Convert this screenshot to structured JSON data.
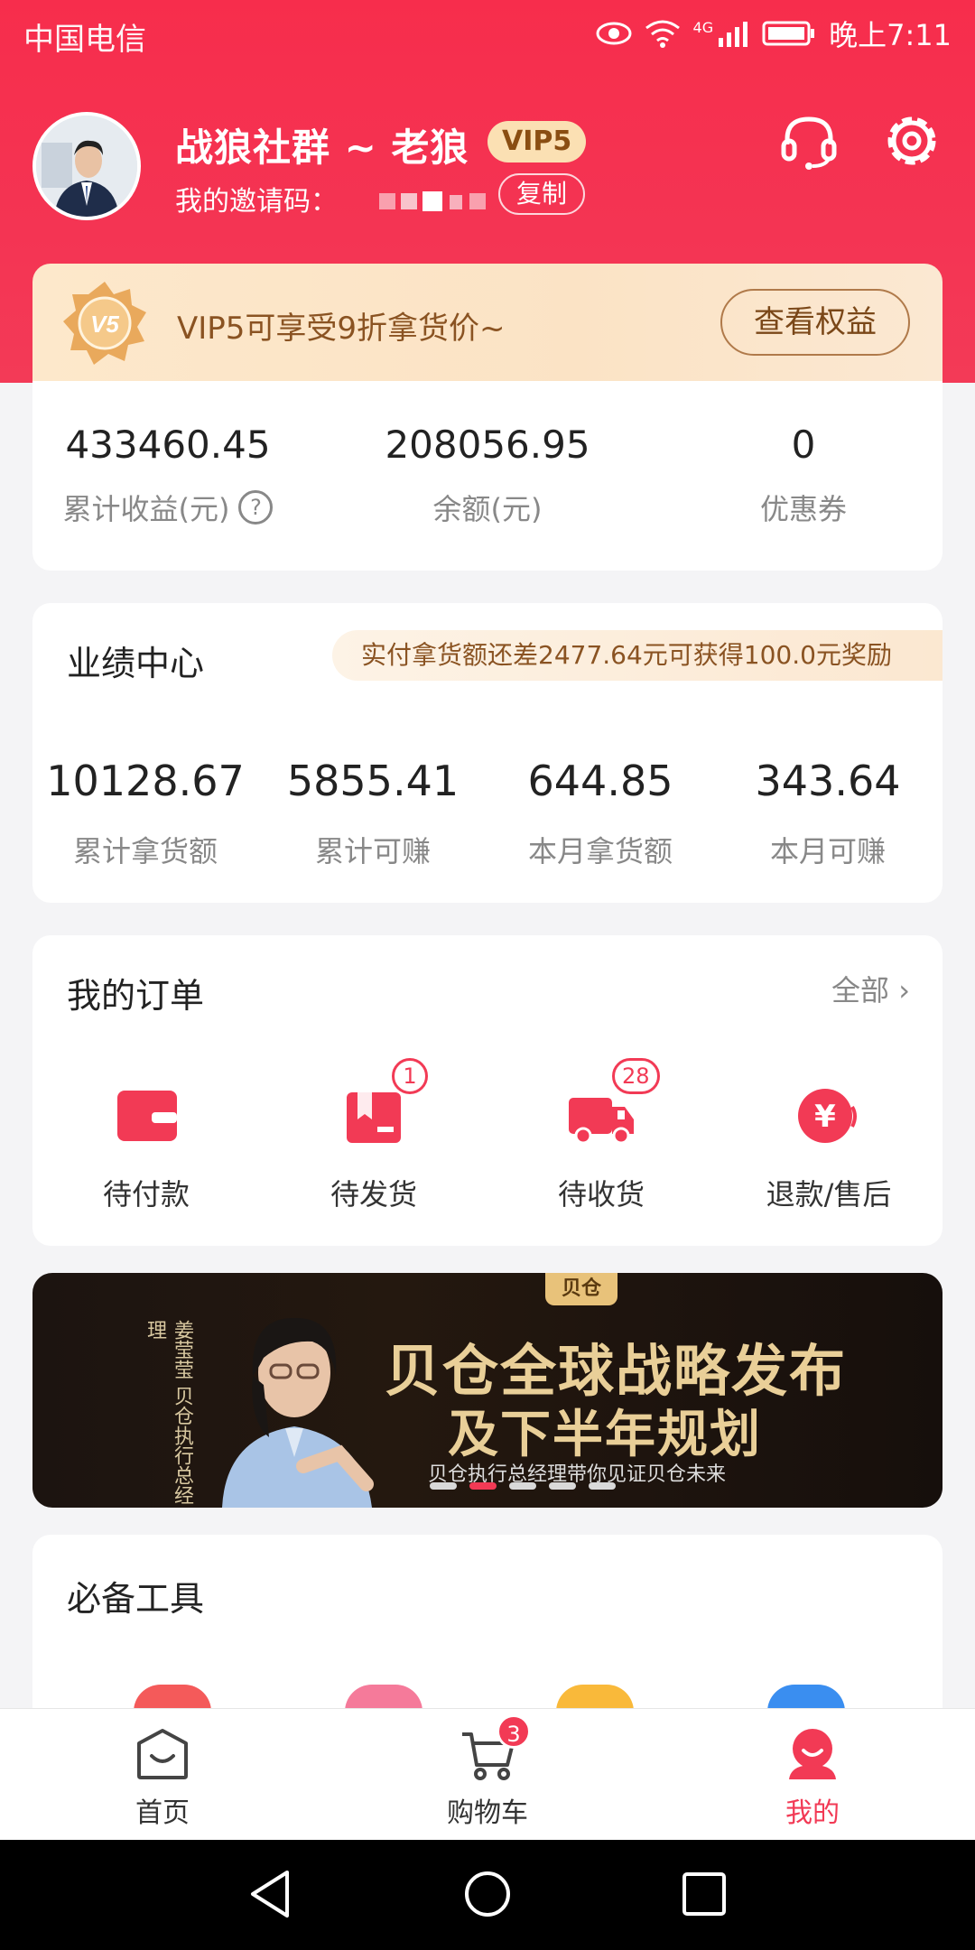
{
  "status_bar": {
    "carrier": "中国电信",
    "network": "4G",
    "time": "晚上7:11"
  },
  "profile": {
    "name": "战狼社群 ~ 老狼",
    "vip_level": "VIP5",
    "invite_label": "我的邀请码：",
    "copy_label": "复制"
  },
  "vip_card": {
    "medal_text": "V5",
    "message": "VIP5可享受9折拿货价~",
    "button": "查看权益"
  },
  "stats": [
    {
      "value": "433460.45",
      "label": "累计收益(元)",
      "has_help": true
    },
    {
      "value": "208056.95",
      "label": "余额(元)"
    },
    {
      "value": "0",
      "label": "优惠券"
    }
  ],
  "performance": {
    "title": "业绩中心",
    "notice": "实付拿货额还差2477.64元可获得100.0元奖励",
    "items": [
      {
        "value": "10128.67",
        "label": "累计拿货额"
      },
      {
        "value": "5855.41",
        "label": "累计可赚"
      },
      {
        "value": "644.85",
        "label": "本月拿货额"
      },
      {
        "value": "343.64",
        "label": "本月可赚"
      }
    ]
  },
  "orders": {
    "title": "我的订单",
    "all_label": "全部",
    "items": [
      {
        "label": "待付款",
        "icon": "wallet-icon",
        "badge": ""
      },
      {
        "label": "待发货",
        "icon": "package-icon",
        "badge": "1"
      },
      {
        "label": "待收货",
        "icon": "truck-icon",
        "badge": "28"
      },
      {
        "label": "退款/售后",
        "icon": "refund-icon",
        "badge": ""
      }
    ]
  },
  "banner": {
    "tag": "贝仓",
    "headline_1": "贝仓全球战略发布",
    "headline_2": "及下半年规划",
    "subline": "贝仓执行总经理带你见证贝仓未来",
    "side_text": "姜莹莹 贝仓执行总经理",
    "slide_count": 5,
    "active_slide": 2
  },
  "tools": {
    "title": "必备工具"
  },
  "tabbar": {
    "items": [
      {
        "label": "首页",
        "icon": "home-icon"
      },
      {
        "label": "购物车",
        "icon": "cart-icon",
        "badge": "3"
      },
      {
        "label": "我的",
        "icon": "profile-icon",
        "active": true
      }
    ]
  },
  "colors": {
    "brand_red": "#f23a55",
    "vip_gold": "#8a5322"
  }
}
